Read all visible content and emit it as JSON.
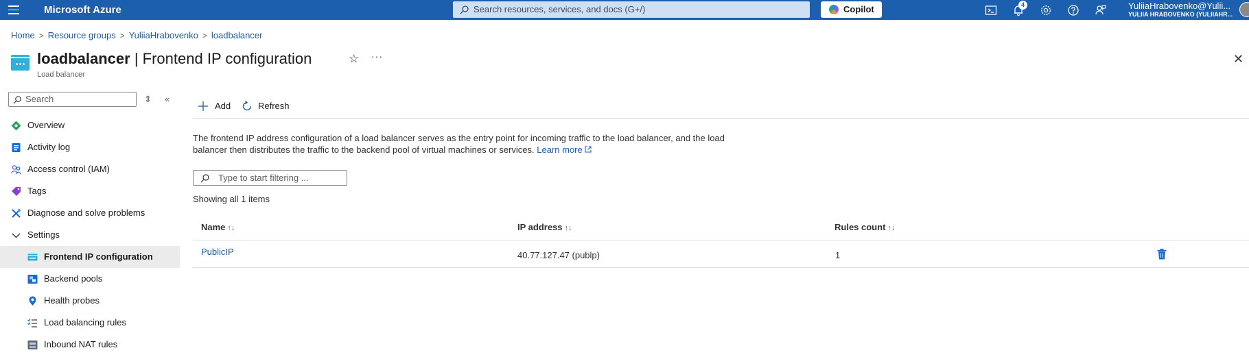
{
  "topbar": {
    "brand": "Microsoft Azure",
    "search_placeholder": "Search resources, services, and docs (G+/)",
    "copilot_label": "Copilot",
    "notification_count": "4",
    "user_name": "YuliiaHrabovenko@Yulii...",
    "user_directory": "YULIIA HRABOVENKO (YULIIAHR..."
  },
  "breadcrumb": [
    "Home",
    "Resource groups",
    "YuliiaHrabovenko",
    "loadbalancer"
  ],
  "header": {
    "resource_name": "loadbalancer",
    "separator": " | ",
    "blade_title": "Frontend IP configuration",
    "subtitle": "Load balancer",
    "more": "···"
  },
  "sidebar": {
    "search_placeholder": "Search",
    "items": [
      {
        "label": "Overview",
        "icon": "overview-icon",
        "level": 1
      },
      {
        "label": "Activity log",
        "icon": "activity-log-icon",
        "level": 1
      },
      {
        "label": "Access control (IAM)",
        "icon": "iam-icon",
        "level": 1
      },
      {
        "label": "Tags",
        "icon": "tag-icon",
        "level": 1
      },
      {
        "label": "Diagnose and solve problems",
        "icon": "diagnose-icon",
        "level": 1
      },
      {
        "label": "Settings",
        "icon": "chevron-down-icon",
        "level": 1
      },
      {
        "label": "Frontend IP configuration",
        "icon": "frontend-ip-icon",
        "level": 2,
        "selected": true
      },
      {
        "label": "Backend pools",
        "icon": "backend-pool-icon",
        "level": 2
      },
      {
        "label": "Health probes",
        "icon": "health-probe-icon",
        "level": 2
      },
      {
        "label": "Load balancing rules",
        "icon": "rules-icon",
        "level": 2
      },
      {
        "label": "Inbound NAT rules",
        "icon": "nat-rules-icon",
        "level": 2
      }
    ]
  },
  "toolbar": {
    "add_label": "Add",
    "refresh_label": "Refresh"
  },
  "main": {
    "description": "The frontend IP address configuration of a load balancer serves as the entry point for incoming traffic to the load balancer, and the load balancer then distributes the traffic to the backend pool of virtual machines or services.",
    "learn_more": "Learn more",
    "filter_placeholder": "Type to start filtering ...",
    "showing_text": "Showing all 1 items"
  },
  "table": {
    "columns": [
      "Name",
      "IP address",
      "Rules count"
    ],
    "sort_glyph": "↑↓",
    "rows": [
      {
        "name": "PublicIP",
        "ip": "40.77.127.47 (publp)",
        "rules_count": "1"
      }
    ]
  },
  "colors": {
    "topbar": "#1b5fae",
    "link": "#1a5ba6",
    "accent": "#0078d4"
  }
}
